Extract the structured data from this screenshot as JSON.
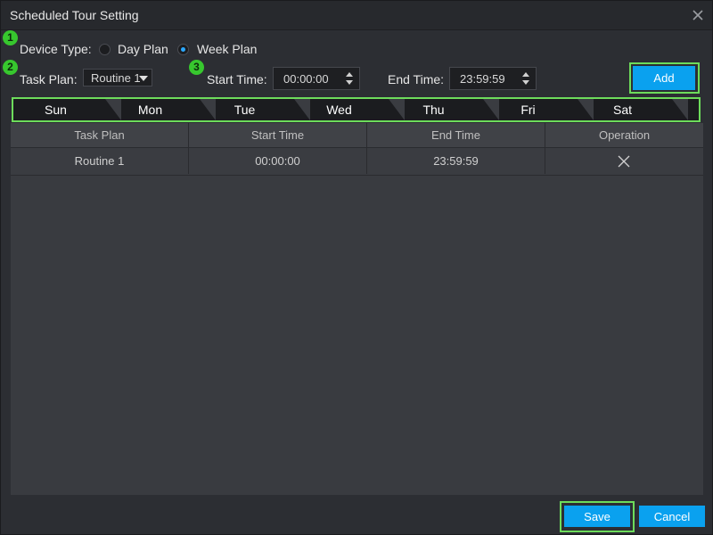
{
  "window": {
    "title": "Scheduled Tour Setting",
    "close_icon": "close-icon"
  },
  "badges": {
    "one": "1",
    "two": "2",
    "three": "3"
  },
  "device_type": {
    "label": "Device Type:",
    "options": [
      {
        "label": "Day Plan",
        "checked": false
      },
      {
        "label": "Week Plan",
        "checked": true
      }
    ]
  },
  "task_plan": {
    "label": "Task Plan:",
    "value": "Routine 1"
  },
  "start_time": {
    "label": "Start Time:",
    "value": "00:00:00"
  },
  "end_time": {
    "label": "End Time:",
    "value": "23:59:59"
  },
  "buttons": {
    "add": "Add",
    "save": "Save",
    "cancel": "Cancel"
  },
  "days": [
    "Sun",
    "Mon",
    "Tue",
    "Wed",
    "Thu",
    "Fri",
    "Sat"
  ],
  "table": {
    "headers": [
      "Task Plan",
      "Start Time",
      "End Time",
      "Operation"
    ],
    "rows": [
      {
        "task_plan": "Routine 1",
        "start_time": "00:00:00",
        "end_time": "23:59:59",
        "operation_icon": "delete-icon"
      }
    ]
  },
  "colors": {
    "accent": "#0aa1ef",
    "highlight": "#6ddc5b",
    "badge": "#37c72e",
    "radio_checked": "#2ba8ff"
  }
}
